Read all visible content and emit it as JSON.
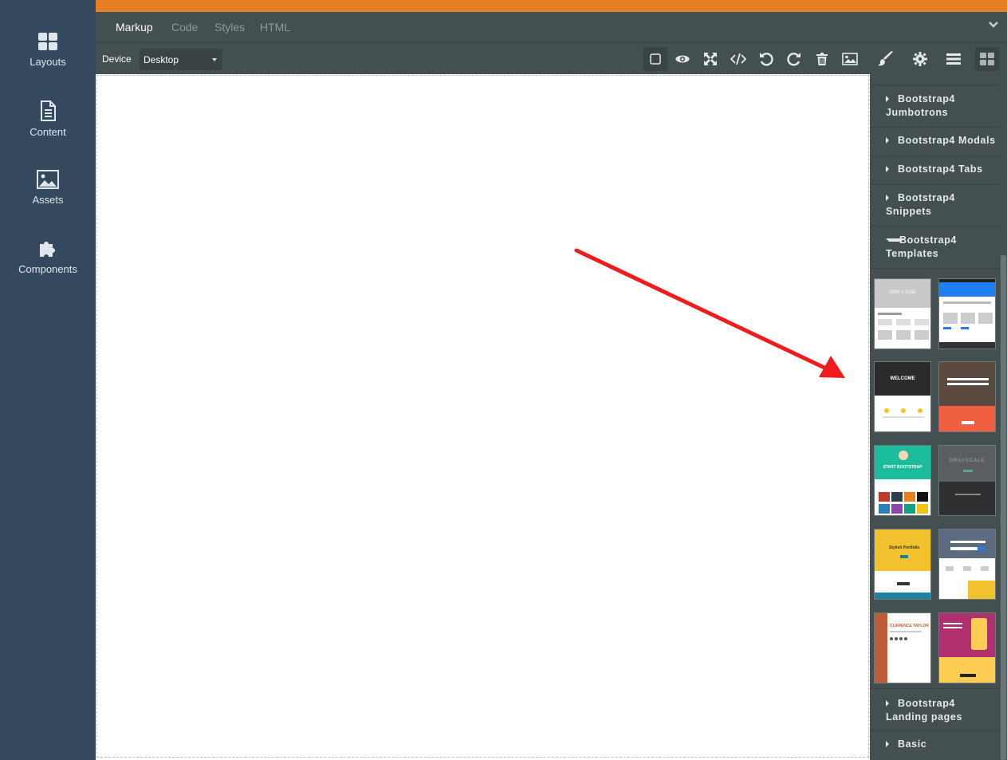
{
  "sidebar": {
    "items": [
      {
        "label": "Layouts",
        "icon": "layouts-icon"
      },
      {
        "label": "Content",
        "icon": "file-icon"
      },
      {
        "label": "Assets",
        "icon": "image-icon"
      },
      {
        "label": "Components",
        "icon": "puzzle-icon"
      }
    ]
  },
  "tabs": [
    {
      "label": "Markup",
      "active": true
    },
    {
      "label": "Code",
      "active": false
    },
    {
      "label": "Styles",
      "active": false
    },
    {
      "label": "HTML",
      "active": false
    }
  ],
  "toolbar": {
    "device_label": "Device",
    "device_value": "Desktop",
    "tools": [
      "square-icon",
      "eye-icon",
      "fullscreen-icon",
      "code-icon",
      "undo-icon",
      "redo-icon",
      "trash-icon",
      "image-icon"
    ],
    "panel_tabs": [
      "brush-icon",
      "gear-icon",
      "menu-icon",
      "blocks-icon"
    ]
  },
  "colors": {
    "sidebar": "#34495e",
    "accent": "#e67e22",
    "panel": "#444f51",
    "arrow": "#ee1c1c"
  },
  "panel": {
    "categories": [
      {
        "line1": "Bootstrap4",
        "line2": "Jumbotrons",
        "open": false
      },
      {
        "line1": "Bootstrap4 Modals",
        "line2": "",
        "open": false
      },
      {
        "line1": "Bootstrap4 Tabs",
        "line2": "",
        "open": false
      },
      {
        "line1": "Bootstrap4",
        "line2": "Snippets",
        "open": false
      },
      {
        "line1": "Bootstrap4",
        "line2": "Templates",
        "open": true
      },
      {
        "line1": "Bootstrap4",
        "line2": "Landing pages",
        "open": false
      },
      {
        "line1": "Basic",
        "line2": "",
        "open": false
      }
    ],
    "templates": [
      {
        "name": "thumb-1",
        "text": "1900 × 1280"
      },
      {
        "name": "thumb-2",
        "text": ""
      },
      {
        "name": "thumb-3",
        "text": "WELCOME"
      },
      {
        "name": "thumb-4",
        "text": ""
      },
      {
        "name": "thumb-5",
        "text": "START BOOTSTRAP"
      },
      {
        "name": "thumb-6",
        "text": "GRAYSCALE"
      },
      {
        "name": "thumb-7",
        "text": "Stylish Portfolio"
      },
      {
        "name": "thumb-8",
        "text": ""
      },
      {
        "name": "thumb-9",
        "text": "CLARENCE TAYLOR"
      },
      {
        "name": "thumb-10",
        "text": ""
      }
    ]
  }
}
